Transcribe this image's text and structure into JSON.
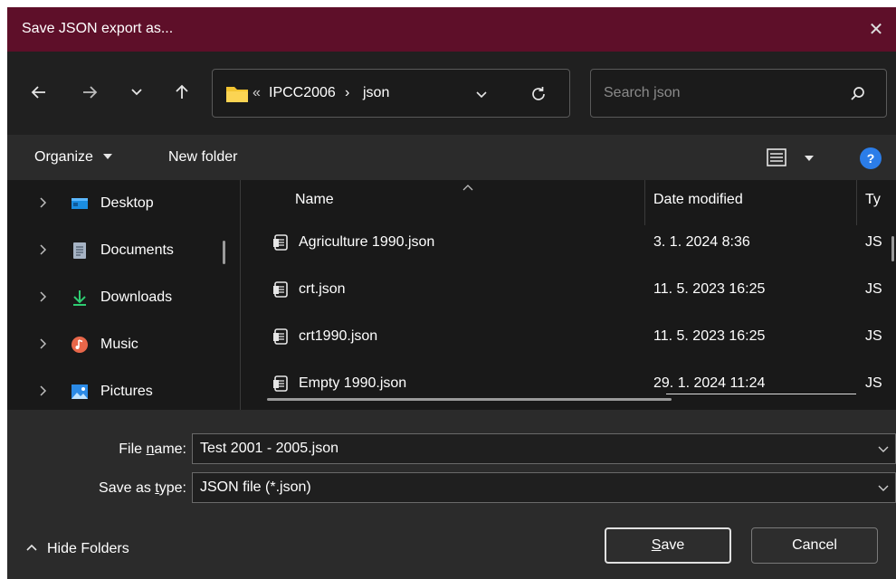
{
  "window": {
    "title": "Save JSON export as...",
    "close_glyph": "✕"
  },
  "nav": {
    "back_icon": "arrow-left-icon",
    "forward_icon": "arrow-right-icon",
    "recent_icon": "chevron-down-icon",
    "up_icon": "arrow-up-icon",
    "refresh_icon": "refresh-icon",
    "address": {
      "overflow": "«",
      "crumbs": [
        "IPCC2006",
        "json"
      ],
      "separator": "›"
    },
    "search_placeholder": "Search json"
  },
  "command_bar": {
    "organize": "Organize",
    "new_folder": "New folder",
    "help": "?"
  },
  "sidebar": {
    "items": [
      {
        "label": "Desktop",
        "icon": "desktop-icon"
      },
      {
        "label": "Documents",
        "icon": "documents-icon"
      },
      {
        "label": "Downloads",
        "icon": "downloads-icon"
      },
      {
        "label": "Music",
        "icon": "music-icon"
      },
      {
        "label": "Pictures",
        "icon": "pictures-icon"
      }
    ]
  },
  "file_list": {
    "columns": [
      "Name",
      "Date modified",
      "Ty"
    ],
    "rows": [
      {
        "name": "Agriculture 1990.json",
        "date": "3. 1. 2024 8:36",
        "type": "JS"
      },
      {
        "name": "crt.json",
        "date": "11. 5. 2023 16:25",
        "type": "JS"
      },
      {
        "name": "crt1990.json",
        "date": "11. 5. 2023 16:25",
        "type": "JS"
      },
      {
        "name": "Empty 1990.json",
        "date": "29. 1. 2024 11:24",
        "type": "JS"
      }
    ]
  },
  "bottom": {
    "file_name_label_pre": "File ",
    "file_name_label_u": "n",
    "file_name_label_post": "ame:",
    "file_name_value": "Test 2001 - 2005.json",
    "save_type_label_pre": "Save as ",
    "save_type_label_u": "t",
    "save_type_label_post": "ype:",
    "save_type_value": "JSON file (*.json)",
    "hide_folders": "Hide Folders",
    "save_u": "S",
    "save_rest": "ave",
    "cancel": "Cancel"
  },
  "colors": {
    "title_bar": "#5e0f29",
    "help_blue": "#2b7de9",
    "folder_yellow": "#f3c431"
  }
}
